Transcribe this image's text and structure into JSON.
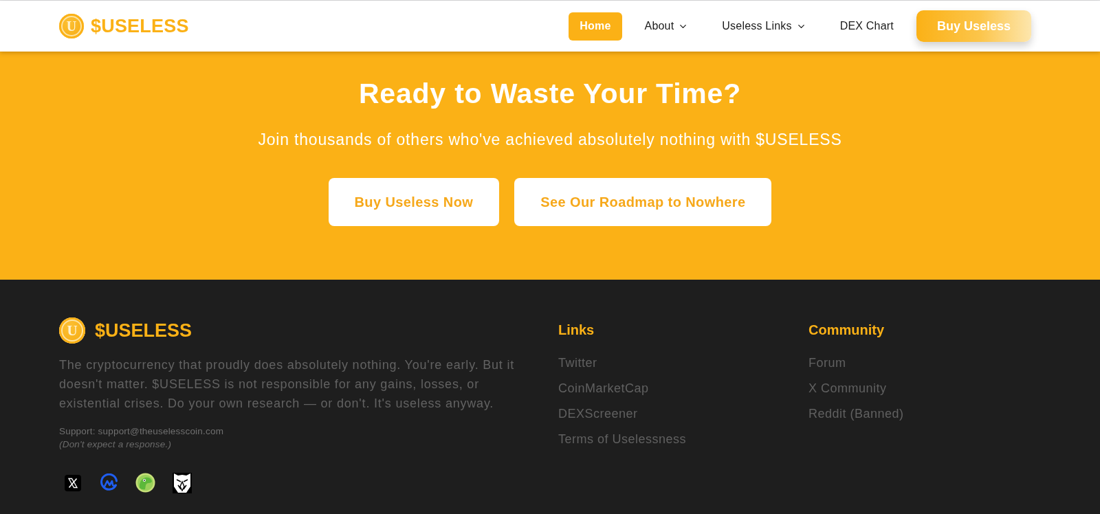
{
  "header": {
    "logo": {
      "mark": "U",
      "text": "$USELESS"
    },
    "nav": [
      {
        "label": "Home",
        "selected": true,
        "dropdown": false
      },
      {
        "label": "About",
        "selected": false,
        "dropdown": true
      },
      {
        "label": "Useless Links",
        "selected": false,
        "dropdown": true
      },
      {
        "label": "DEX Chart",
        "selected": false,
        "dropdown": false
      }
    ],
    "cta": "Buy Useless"
  },
  "hero": {
    "title": "Ready to Waste Your Time?",
    "subtitle": "Join thousands of others who've achieved absolutely nothing with $USELESS",
    "buttons": [
      "Buy Useless Now",
      "See Our Roadmap to Nowhere"
    ]
  },
  "footer": {
    "brand": {
      "mark": "U",
      "text": "$USELESS"
    },
    "description": "The cryptocurrency that proudly does absolutely nothing. You're early. But it doesn't matter. $USELESS is not responsible for any gains, losses, or existential crises. Do your own research — or don't. It's useless anyway.",
    "support": "Support: support@theuselesscoin.com",
    "support_note": "(Don't expect a response.)",
    "columns": [
      {
        "title": "Links",
        "items": [
          "Twitter",
          "CoinMarketCap",
          "DEXScreener",
          "Terms of Uselessness"
        ]
      },
      {
        "title": "Community",
        "items": [
          "Forum",
          "X Community",
          "Reddit (Banned)"
        ]
      }
    ]
  }
}
